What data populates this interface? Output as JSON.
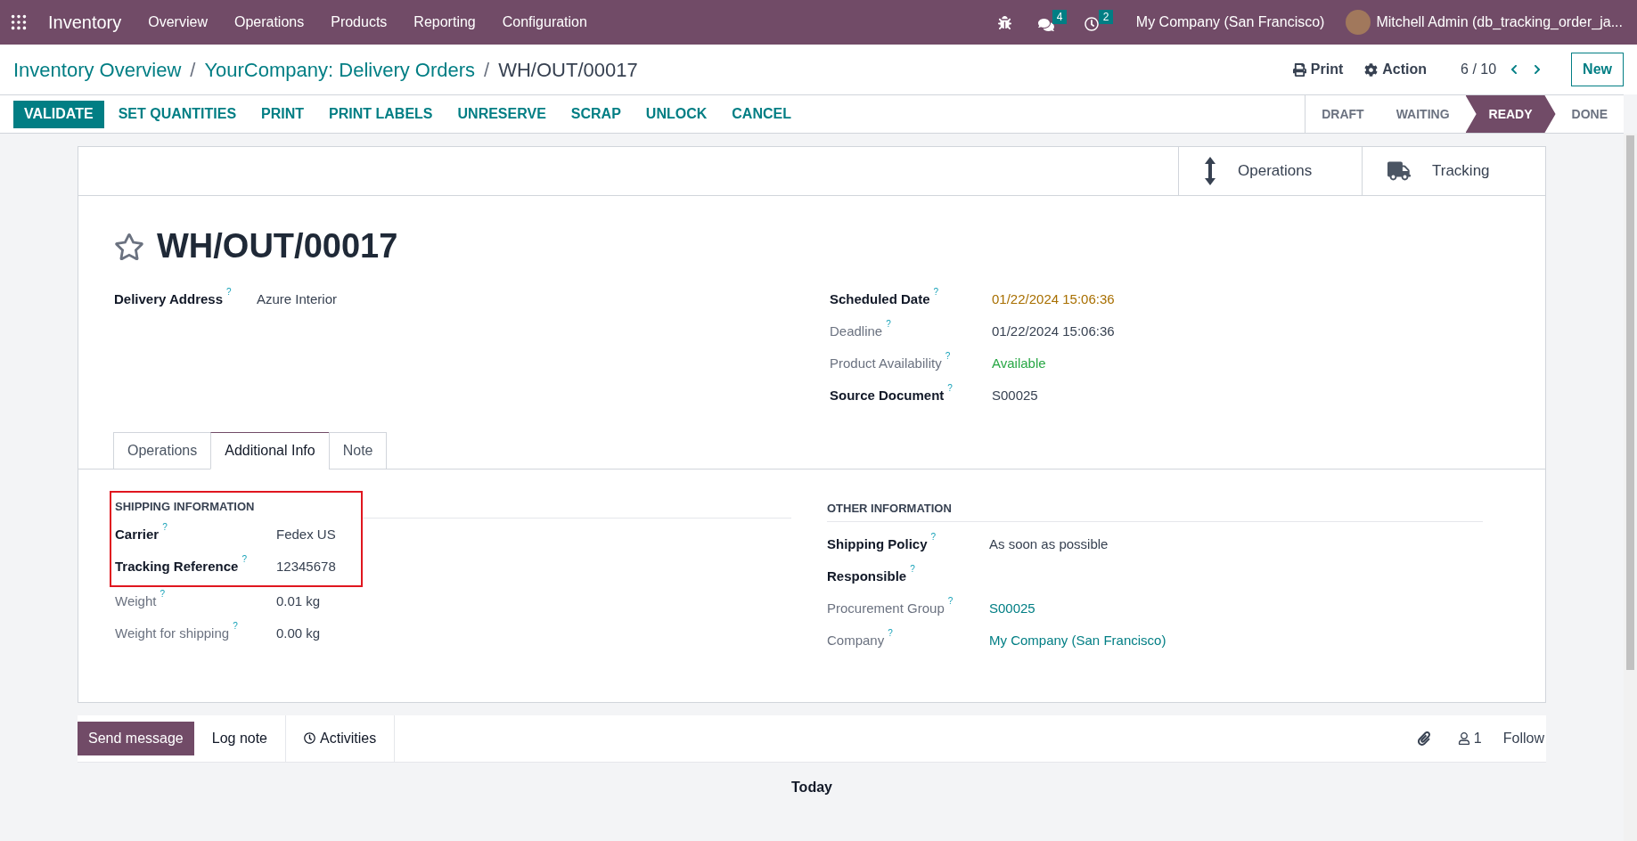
{
  "navbar": {
    "app": "Inventory",
    "menu": [
      "Overview",
      "Operations",
      "Products",
      "Reporting",
      "Configuration"
    ],
    "messages_badge": "4",
    "activities_badge": "2",
    "company": "My Company (San Francisco)",
    "user": "Mitchell Admin (db_tracking_order_ja..."
  },
  "breadcrumbs": [
    {
      "label": "Inventory Overview",
      "link": true
    },
    {
      "label": "YourCompany: Delivery Orders",
      "link": true
    },
    {
      "label": "WH/OUT/00017",
      "link": false
    }
  ],
  "breadcrumb_separator": "/",
  "control_panel": {
    "print": "Print",
    "action": "Action",
    "pager": "6 / 10",
    "new": "New"
  },
  "actions": [
    {
      "label": "VALIDATE",
      "primary": true
    },
    {
      "label": "SET QUANTITIES",
      "primary": false
    },
    {
      "label": "PRINT",
      "primary": false
    },
    {
      "label": "PRINT LABELS",
      "primary": false
    },
    {
      "label": "UNRESERVE",
      "primary": false
    },
    {
      "label": "SCRAP",
      "primary": false
    },
    {
      "label": "UNLOCK",
      "primary": false
    },
    {
      "label": "CANCEL",
      "primary": false
    }
  ],
  "stages": [
    {
      "label": "DRAFT",
      "selected": false
    },
    {
      "label": "WAITING",
      "selected": false
    },
    {
      "label": "READY",
      "selected": true
    },
    {
      "label": "DONE",
      "selected": false
    }
  ],
  "stat_buttons": [
    {
      "kind": "updown",
      "label": "Operations"
    },
    {
      "kind": "truck",
      "label": "Tracking"
    }
  ],
  "record": {
    "title": "WH/OUT/00017",
    "starred": false,
    "left_fields": [
      {
        "label": "Delivery Address",
        "help": "?",
        "value": "Azure Interior",
        "bold": true,
        "kind": "plain"
      }
    ],
    "right_fields": [
      {
        "label": "Scheduled Date",
        "help": "?",
        "value": "01/22/2024 15:06:36",
        "bold": true,
        "kind": "warning"
      },
      {
        "label": "Deadline",
        "help": "?",
        "value": "01/22/2024 15:06:36",
        "bold": false,
        "kind": "plain"
      },
      {
        "label": "Product Availability",
        "help": "?",
        "value": "Available",
        "bold": false,
        "kind": "success"
      },
      {
        "label": "Source Document",
        "help": "?",
        "value": "S00025",
        "bold": true,
        "kind": "plain"
      }
    ]
  },
  "tabs": [
    {
      "label": "Operations",
      "selected": false
    },
    {
      "label": "Additional Info",
      "selected": true
    },
    {
      "label": "Note",
      "selected": false
    }
  ],
  "shipping": {
    "heading": "SHIPPING INFORMATION",
    "highlighted_fields": [
      {
        "label": "Carrier",
        "help": "?",
        "value": "Fedex US",
        "bold": true,
        "kind": "plain"
      },
      {
        "label": "Tracking Reference",
        "help": "?",
        "value": "12345678",
        "bold": true,
        "kind": "plain"
      }
    ],
    "fields": [
      {
        "label": "Weight",
        "help": "?",
        "value": "0.01 kg",
        "bold": false,
        "kind": "plain"
      },
      {
        "label": "Weight for shipping",
        "help": "?",
        "value": "0.00 kg",
        "bold": false,
        "kind": "plain"
      }
    ]
  },
  "other": {
    "heading": "OTHER INFORMATION",
    "fields": [
      {
        "label": "Shipping Policy",
        "help": "?",
        "value": "As soon as possible",
        "bold": true,
        "kind": "plain"
      },
      {
        "label": "Responsible",
        "help": "?",
        "bold": true
      },
      {
        "label": "Procurement Group",
        "help": "?",
        "value": "S00025",
        "bold": false,
        "kind": "link"
      },
      {
        "label": "Company",
        "help": "?",
        "value": "My Company (San Francisco)",
        "bold": false,
        "kind": "link"
      }
    ]
  },
  "chatter": {
    "tabs": [
      {
        "kind": "send",
        "label": "Send message",
        "selected": true
      },
      {
        "kind": "note",
        "label": "Log note",
        "selected": false
      },
      {
        "kind": "activities",
        "label": "Activities",
        "selected": false
      }
    ],
    "followers": "1",
    "follow": "Follow",
    "date_separator": "Today"
  }
}
